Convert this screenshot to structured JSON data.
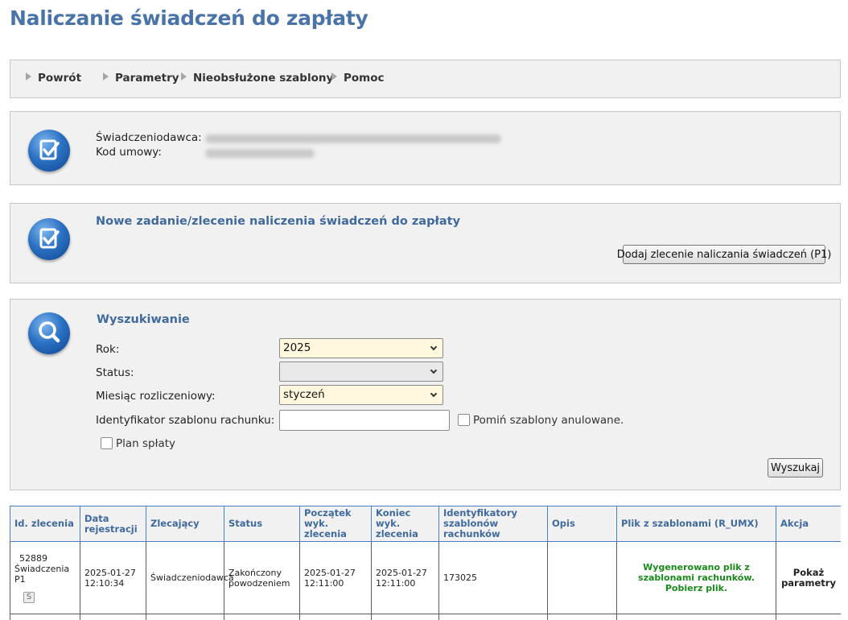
{
  "page": {
    "title": "Naliczanie świadczeń do zapłaty"
  },
  "nav": {
    "items": [
      {
        "label": "Powrót"
      },
      {
        "label": "Parametry"
      },
      {
        "label": "Nieobsłużone szablony"
      },
      {
        "label": "Pomoc"
      }
    ]
  },
  "info": {
    "provider_label": "Świadczeniodawca:",
    "contract_label": "Kod umowy:"
  },
  "new_task": {
    "title": "Nowe zadanie/zlecenie naliczenia świadczeń do zapłaty",
    "add_button": "Dodaj zlecenie naliczania świadczeń (P1)"
  },
  "search": {
    "title": "Wyszukiwanie",
    "year_label": "Rok:",
    "year_value": "2025",
    "status_label": "Status:",
    "status_value": "",
    "month_label": "Miesiąc rozliczeniowy:",
    "month_value": "styczeń",
    "template_id_label": "Identyfikator szablonu rachunku:",
    "template_id_value": "",
    "skip_cancelled_label": "Pomiń szablony anulowane.",
    "payment_plan_label": "Plan spłaty",
    "search_button": "Wyszukaj"
  },
  "table": {
    "headers": {
      "id": "Id. zlecenia",
      "reg_date": "Data rejestracji",
      "requester": "Zlecający",
      "status": "Status",
      "start": "Początek wyk. zlecenia",
      "end": "Koniec wyk. zlecenia",
      "template_ids": "Identyfikatory szablonów rachunków",
      "description": "Opis",
      "file": "Plik z szablonami (R_UMX)",
      "action": "Akcja"
    },
    "rows": [
      {
        "id": "52889",
        "type": "Świadczenia P1",
        "badge": "S",
        "reg_date": "2025-01-27",
        "reg_time": "12:10:34",
        "requester": "Świadczeniodawca",
        "status": "Zakończony powodzeniem",
        "start_date": "2025-01-27",
        "start_time": "12:11:00",
        "end_date": "2025-01-27",
        "end_time": "12:11:00",
        "template_ids": "173025",
        "description": "",
        "file": "Wygenerowano plik z szablonami rachunków. Pobierz plik.",
        "action": "Pokaż parametry"
      }
    ]
  }
}
